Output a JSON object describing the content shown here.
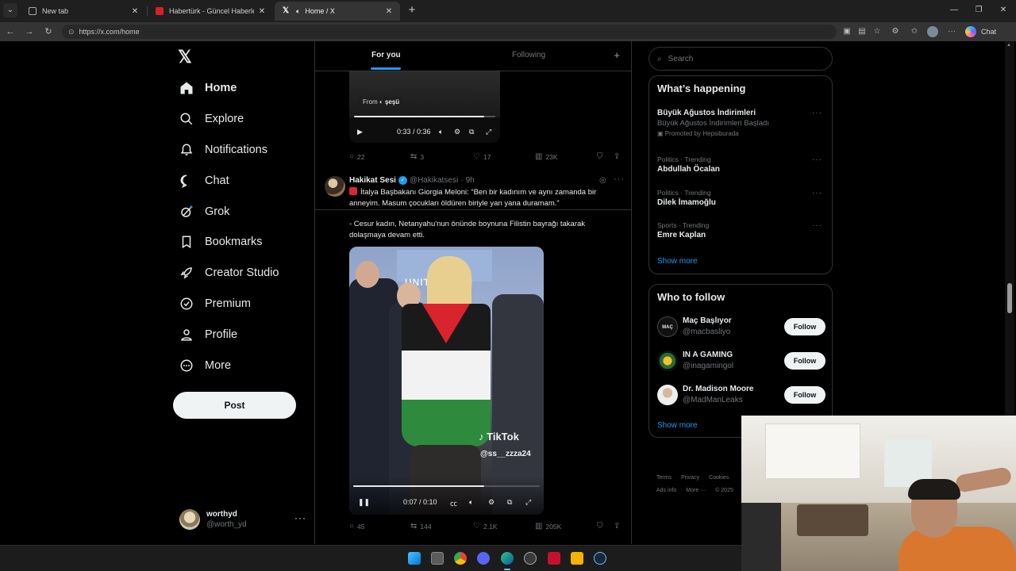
{
  "browser": {
    "tabs": [
      {
        "title": "New tab",
        "icon": "new-tab-icon",
        "active": false
      },
      {
        "title": "Habertürk - Güncel Haberler, Son Dakika",
        "icon": "haberturk-icon",
        "active": false
      },
      {
        "title": "Home / X",
        "icon": "x-icon",
        "active": true
      }
    ],
    "url": "https://x.com/home",
    "copilot_label": "Chat"
  },
  "nav": {
    "items": [
      {
        "label": "Home",
        "icon": "home-icon"
      },
      {
        "label": "Explore",
        "icon": "search-icon"
      },
      {
        "label": "Notifications",
        "icon": "bell-icon"
      },
      {
        "label": "Chat",
        "icon": "chat-bubble-icon"
      },
      {
        "label": "Grok",
        "icon": "grok-icon"
      },
      {
        "label": "Bookmarks",
        "icon": "bookmark-icon"
      },
      {
        "label": "Creator Studio",
        "icon": "rocket-icon"
      },
      {
        "label": "Premium",
        "icon": "verified-badge-icon"
      },
      {
        "label": "Profile",
        "icon": "person-icon"
      },
      {
        "label": "More",
        "icon": "more-circle-icon"
      }
    ],
    "post_label": "Post",
    "account": {
      "name": "worthyd",
      "handle": "@worth_yd"
    }
  },
  "feed": {
    "tabs": {
      "for_you": "For you",
      "following": "Following"
    },
    "prev_tweet": {
      "from_label": "From",
      "from_name": "şeşü",
      "video_time": "0:33 / 0:36",
      "video_progress": 0.92,
      "stats": {
        "replies": "22",
        "reposts": "3",
        "likes": "17",
        "views": "23K"
      }
    },
    "tweet": {
      "name": "Hakikat Sesi",
      "handle": "@Hakikatsesi",
      "time": "9h",
      "text1": "İtalya Başbakanı Giorgia Meloni: “Ben bir kadınım ve aynı zamanda bir anneyim. Masum çocukları öldüren biriyle yan yana duramam.”",
      "text2": "- Cesur kadın, Netanyahu'nun önünde boynuna Filistin bayrağı takarak dolaşmaya devam etti.",
      "video_time": "0:07 / 0:10",
      "video_progress": 0.7,
      "video_banner": "UNITED NATI",
      "watermark": "TikTok",
      "watermark_handle": "@ss__zzza24",
      "stats": {
        "replies": "45",
        "reposts": "144",
        "likes": "2.1K",
        "views": "205K"
      }
    }
  },
  "sidebar": {
    "search_placeholder": "Search",
    "happening": {
      "title": "What’s happening",
      "trends": [
        {
          "context": "",
          "title": "Büyük Ağustos İndirimleri",
          "subtitle": "Büyük Ağustos İndirimleri Başladı",
          "promo": "Promoted by Hepsiburada"
        },
        {
          "context": "Politics · Trending",
          "title": "Abdullah Öcalan",
          "subtitle": "",
          "promo": ""
        },
        {
          "context": "Politics · Trending",
          "title": "Dilek İmamoğlu",
          "subtitle": "",
          "promo": ""
        },
        {
          "context": "Sports · Trending",
          "title": "Emre Kaplan",
          "subtitle": "",
          "promo": ""
        }
      ],
      "show_more": "Show more"
    },
    "who_to_follow": {
      "title": "Who to follow",
      "accounts": [
        {
          "name": "Maç Başlıyor",
          "handle": "@macbasliyo",
          "avatar_text": "MAÇ"
        },
        {
          "name": "IN A GAMING",
          "handle": "@inagamingol",
          "avatar_text": ""
        },
        {
          "name": "Dr. Madison Moore",
          "handle": "@MadManLeaks",
          "avatar_text": ""
        }
      ],
      "follow_label": "Follow",
      "show_more": "Show more"
    },
    "footer": {
      "terms": "Terms",
      "privacy": "Privacy",
      "cookies": "Cookies",
      "ads": "Ads info",
      "more": "More ···",
      "copyright": "© 2025"
    }
  },
  "colors": {
    "accent": "#1d9bf0",
    "background": "#000000",
    "border": "#2f3336",
    "muted": "#71767b"
  }
}
